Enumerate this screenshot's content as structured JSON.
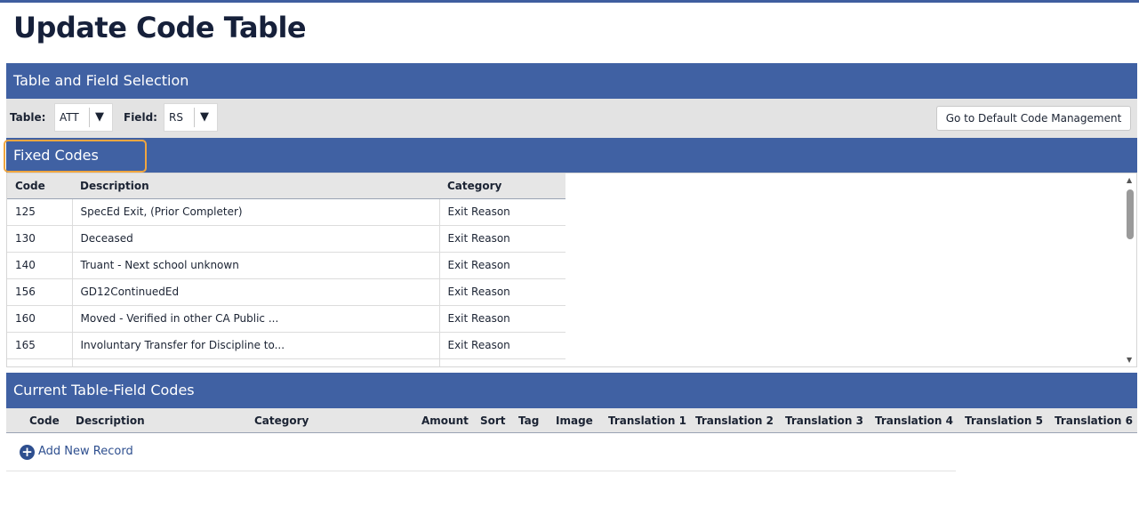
{
  "page": {
    "title": "Update Code Table"
  },
  "table_field_selection": {
    "title": "Table and Field Selection",
    "table_label": "Table:",
    "table_value": "ATT",
    "field_label": "Field:",
    "field_value": "RS",
    "default_button_label": "Go to Default Code Management"
  },
  "fixed_codes": {
    "title": "Fixed Codes",
    "columns": [
      "Code",
      "Description",
      "Category"
    ],
    "rows": [
      {
        "code": "125",
        "description": "SpecEd Exit, (Prior Completer)",
        "category": "Exit Reason"
      },
      {
        "code": "130",
        "description": "Deceased",
        "category": "Exit Reason"
      },
      {
        "code": "140",
        "description": "Truant - Next school unknown",
        "category": "Exit Reason"
      },
      {
        "code": "156",
        "description": "GD12ContinuedEd",
        "category": "Exit Reason"
      },
      {
        "code": "160",
        "description": "Moved - Verified in other CA Public ...",
        "category": "Exit Reason"
      },
      {
        "code": "165",
        "description": "Involuntary Transfer for Discipline to...",
        "category": "Exit Reason"
      }
    ]
  },
  "current_codes": {
    "title": "Current Table-Field Codes",
    "columns": [
      "Code",
      "Description",
      "Category",
      "Amount",
      "Sort",
      "Tag",
      "Image",
      "Translation 1",
      "Translation 2",
      "Translation 3",
      "Translation 4",
      "Translation 5",
      "Translation 6"
    ],
    "add_label": "Add New Record"
  },
  "colors": {
    "header_bar": "#4061a3",
    "highlight": "#f0a640",
    "link": "#2e4f8f"
  },
  "icons": {
    "dropdown": "caret-down-icon",
    "add": "plus-circle-icon",
    "scroll_up": "arrow-up-icon",
    "scroll_down": "arrow-down-icon"
  }
}
